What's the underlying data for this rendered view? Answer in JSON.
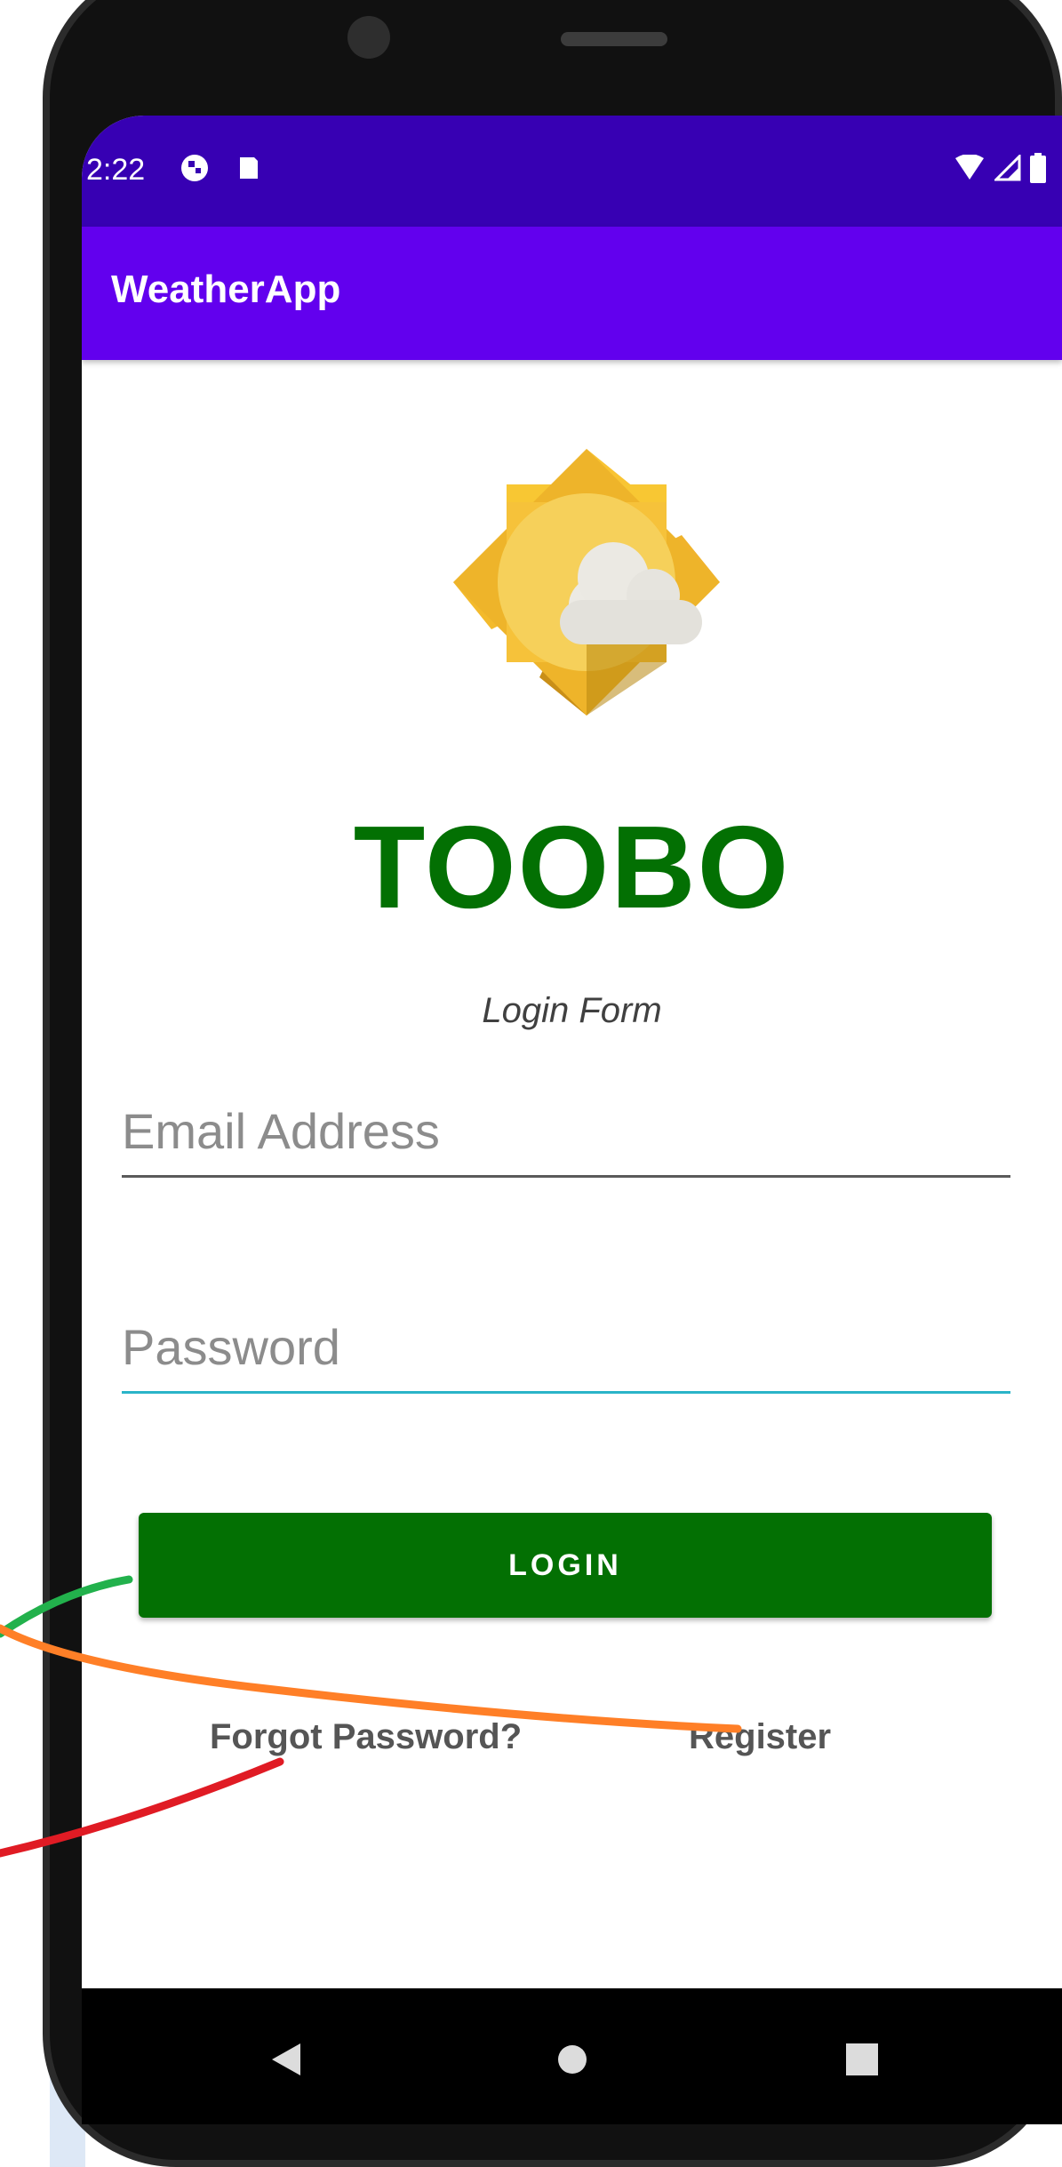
{
  "status_bar": {
    "time": "2:22",
    "left_icons": [
      "notification-icon",
      "sd-card-icon"
    ],
    "right_icons": [
      "wifi-icon",
      "signal-icon",
      "battery-icon"
    ]
  },
  "app_bar": {
    "title": "WeatherApp"
  },
  "login": {
    "brand": "TOOBO",
    "subtitle": "Login Form",
    "email_placeholder": "Email Address",
    "password_placeholder": "Password",
    "login_label": "LOGIN",
    "forgot_label": "Forgot Password?",
    "register_label": "Register"
  },
  "nav_bar": {
    "buttons": [
      "back-icon",
      "home-icon",
      "recents-icon"
    ]
  },
  "colors": {
    "status_bar": "#3700b3",
    "app_bar": "#6200ee",
    "brand_green": "#037003",
    "annotation_green": "#22b14c",
    "annotation_orange": "#ff7f27",
    "annotation_red": "#e01b24"
  }
}
